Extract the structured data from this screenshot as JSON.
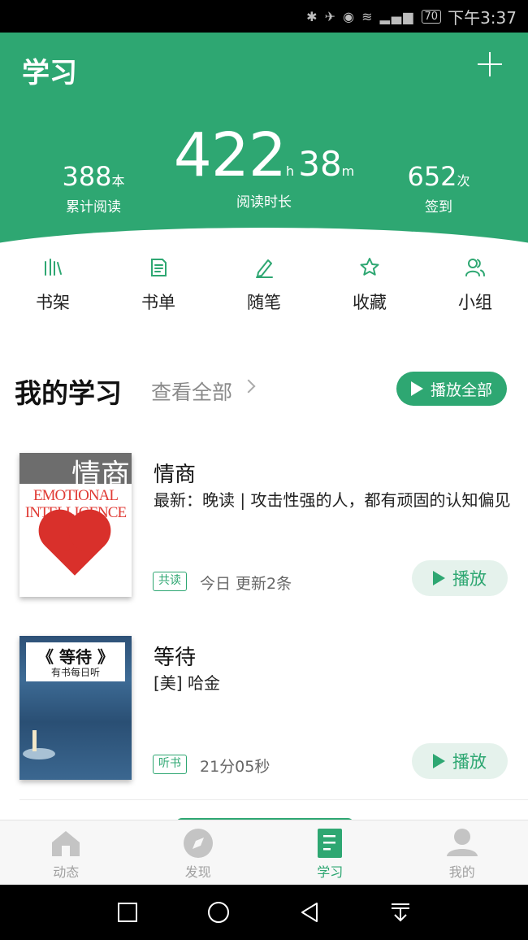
{
  "status_bar": {
    "icons": "✱ ✈ ◉ ≋ ▂▄▆",
    "battery": "70",
    "time": "下午3:37"
  },
  "header": {
    "title": "学习",
    "stats": {
      "books": {
        "value": "388",
        "unit": "本",
        "label": "累计阅读"
      },
      "time": {
        "hours": "422",
        "h_unit": "h",
        "minutes": "38",
        "m_unit": "m",
        "label": "阅读时长"
      },
      "checkin": {
        "value": "652",
        "unit": "次",
        "label": "签到"
      }
    }
  },
  "quick_actions": [
    {
      "label": "书架",
      "icon": "bookshelf-icon"
    },
    {
      "label": "书单",
      "icon": "booklist-icon"
    },
    {
      "label": "随笔",
      "icon": "pen-icon"
    },
    {
      "label": "收藏",
      "icon": "star-icon"
    },
    {
      "label": "小组",
      "icon": "group-icon"
    }
  ],
  "section": {
    "title": "我的学习",
    "view_all": "查看全部",
    "play_all": "播放全部"
  },
  "cards": [
    {
      "title": "情商",
      "desc": "最新：晚读 | 攻击性强的人，都有顽固的认知偏见",
      "tag": "共读",
      "meta": "今日 更新2条",
      "play": "播放",
      "cover": {
        "chars": "情商",
        "en": "EMOTIONAL INTELLIGENCE"
      }
    },
    {
      "title": "等待",
      "desc": "[美] 哈金",
      "tag": "听书",
      "meta": "21分05秒",
      "play": "播放",
      "cover": {
        "title": "《 等待 》",
        "subtitle": "有书每日听"
      }
    }
  ],
  "tabs": [
    {
      "label": "动态",
      "icon": "home-icon",
      "active": false
    },
    {
      "label": "发现",
      "icon": "compass-icon",
      "active": false
    },
    {
      "label": "学习",
      "icon": "study-icon",
      "active": true
    },
    {
      "label": "我的",
      "icon": "profile-icon",
      "active": false
    }
  ],
  "colors": {
    "brand": "#2ea772",
    "brand_light": "#e5f2ec",
    "inactive_tab": "#a0a0a0"
  }
}
